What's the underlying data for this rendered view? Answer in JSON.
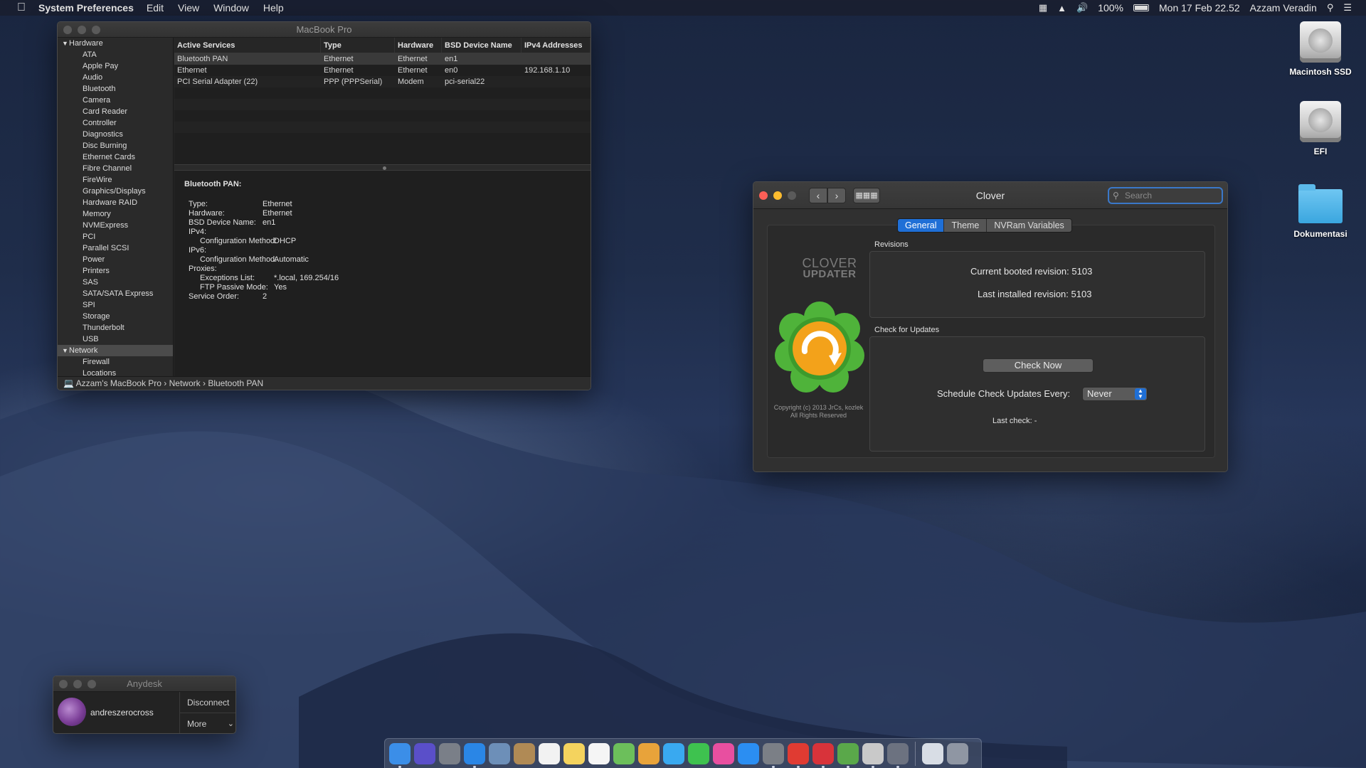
{
  "menubar": {
    "app_name": "System Preferences",
    "menus": [
      "Edit",
      "View",
      "Window",
      "Help"
    ],
    "battery": "100%",
    "datetime": "Mon 17 Feb  22.52",
    "user": "Azzam Veradin"
  },
  "desktop_icons": [
    "Macintosh SSD",
    "EFI",
    "Dokumentasi"
  ],
  "sysinfo": {
    "title": "MacBook Pro",
    "hardware_group": "Hardware",
    "hardware_items": [
      "ATA",
      "Apple Pay",
      "Audio",
      "Bluetooth",
      "Camera",
      "Card Reader",
      "Controller",
      "Diagnostics",
      "Disc Burning",
      "Ethernet Cards",
      "Fibre Channel",
      "FireWire",
      "Graphics/Displays",
      "Hardware RAID",
      "Memory",
      "NVMExpress",
      "PCI",
      "Parallel SCSI",
      "Power",
      "Printers",
      "SAS",
      "SATA/SATA Express",
      "SPI",
      "Storage",
      "Thunderbolt",
      "USB"
    ],
    "network_group": "Network",
    "network_items": [
      "Firewall",
      "Locations"
    ],
    "columns": [
      "Active Services",
      "Type",
      "Hardware",
      "BSD Device Name",
      "IPv4 Addresses"
    ],
    "rows": [
      [
        "Bluetooth PAN",
        "Ethernet",
        "Ethernet",
        "en1",
        ""
      ],
      [
        "Ethernet",
        "Ethernet",
        "Ethernet",
        "en0",
        "192.168.1.10"
      ],
      [
        "PCI Serial Adapter (22)",
        "PPP (PPPSerial)",
        "Modem",
        "pci-serial22",
        ""
      ]
    ],
    "detail_title": "Bluetooth PAN:",
    "detail": [
      {
        "k": "Type:",
        "v": "Ethernet",
        "indent": 0
      },
      {
        "k": "Hardware:",
        "v": "Ethernet",
        "indent": 0
      },
      {
        "k": "BSD Device Name:",
        "v": "en1",
        "indent": 0
      },
      {
        "k": "IPv4:",
        "v": "",
        "indent": 0
      },
      {
        "k": "Configuration Method:",
        "v": "DHCP",
        "indent": 1
      },
      {
        "k": "IPv6:",
        "v": "",
        "indent": 0
      },
      {
        "k": "Configuration Method:",
        "v": "Automatic",
        "indent": 1
      },
      {
        "k": "Proxies:",
        "v": "",
        "indent": 0
      },
      {
        "k": "Exceptions List:",
        "v": "*.local, 169.254/16",
        "indent": 1
      },
      {
        "k": "FTP Passive Mode:",
        "v": "Yes",
        "indent": 1
      },
      {
        "k": "Service Order:",
        "v": "2",
        "indent": 0
      }
    ],
    "path": [
      "Azzam's MacBook Pro",
      "Network",
      "Bluetooth PAN"
    ]
  },
  "clover": {
    "title": "Clover",
    "search_placeholder": "Search",
    "tabs": [
      "General",
      "Theme",
      "NVRam Variables"
    ],
    "active_tab": "General",
    "logo_line1": "CLOVER",
    "logo_line2": "UPDATER",
    "copyright_line1": "Copyright (c) 2013 JrCs, kozlek",
    "copyright_line2": "All Rights Reserved",
    "revisions_label": "Revisions",
    "current_label": "Current booted revision:",
    "current_value": "5103",
    "installed_label": "Last installed revision:",
    "installed_value": "5103",
    "updates_label": "Check for Updates",
    "check_now": "Check Now",
    "schedule_label": "Schedule Check Updates Every:",
    "schedule_value": "Never",
    "last_check": "Last check: -"
  },
  "anydesk": {
    "title": "Anydesk",
    "user": "andreszerocross",
    "disconnect": "Disconnect",
    "more": "More"
  },
  "dock": {
    "apps": [
      {
        "name": "finder",
        "color": "#3b8ee8",
        "running": true
      },
      {
        "name": "siri",
        "color": "#5a4fc9",
        "running": false
      },
      {
        "name": "launchpad",
        "color": "#7a7f88",
        "running": false
      },
      {
        "name": "safari",
        "color": "#2a86e6",
        "running": true
      },
      {
        "name": "preview",
        "color": "#6d8fb8",
        "running": false
      },
      {
        "name": "contacts",
        "color": "#b08a55",
        "running": false
      },
      {
        "name": "calendar",
        "color": "#f2f2f2",
        "running": false
      },
      {
        "name": "notes",
        "color": "#f4d35e",
        "running": false
      },
      {
        "name": "reminders",
        "color": "#f5f5f5",
        "running": false
      },
      {
        "name": "maps",
        "color": "#6cbf5b",
        "running": false
      },
      {
        "name": "photos",
        "color": "#e8a33a",
        "running": false
      },
      {
        "name": "messages",
        "color": "#39a9f0",
        "running": false
      },
      {
        "name": "facetime",
        "color": "#3ec24f",
        "running": false
      },
      {
        "name": "itunes",
        "color": "#e84fa0",
        "running": false
      },
      {
        "name": "app-store",
        "color": "#2b8ef2",
        "running": false
      },
      {
        "name": "system-preferences",
        "color": "#7b7f86",
        "running": true
      },
      {
        "name": "anydesk",
        "color": "#e03b32",
        "running": true
      },
      {
        "name": "anydesk-alt",
        "color": "#d8333a",
        "running": true
      },
      {
        "name": "clover",
        "color": "#5aa84a",
        "running": true
      },
      {
        "name": "script-editor",
        "color": "#c9c9c9",
        "running": true
      },
      {
        "name": "utility",
        "color": "#6c7280",
        "running": true
      }
    ],
    "trailing": [
      {
        "name": "downloads",
        "color": "#d8dde5"
      },
      {
        "name": "trash",
        "color": "#8f96a3"
      }
    ]
  }
}
